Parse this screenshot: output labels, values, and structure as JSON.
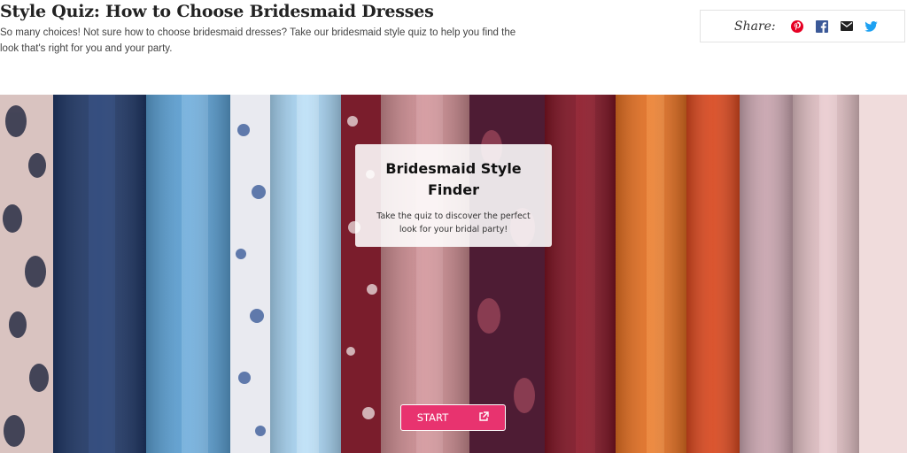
{
  "header": {
    "title": "Style Quiz: How to Choose Bridesmaid Dresses",
    "description": "So many choices! Not sure how to choose bridesmaid dresses? Take our bridesmaid style quiz to help you find the look that's right for you and your party."
  },
  "share": {
    "label": "Share:",
    "icons": [
      "pinterest-icon",
      "facebook-icon",
      "email-icon",
      "twitter-icon"
    ]
  },
  "quiz": {
    "title": "Bridesmaid Style Finder",
    "subtitle": "Take the quiz to discover the perfect look for your bridal party!",
    "start_label": "START",
    "start_icon": "external-link-icon"
  },
  "colors": {
    "accent": "#e8336f",
    "pinterest": "#e60023",
    "facebook": "#3b5998",
    "twitter": "#1da1f2"
  }
}
